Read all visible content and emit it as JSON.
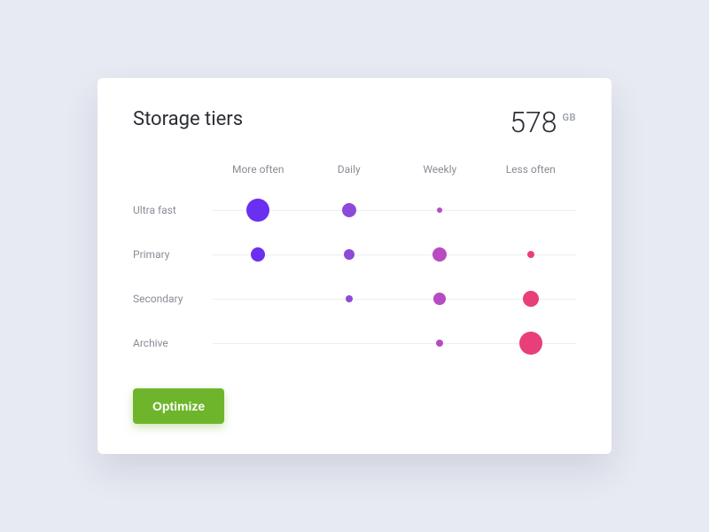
{
  "title": "Storage tiers",
  "total": {
    "value": "578",
    "unit": "GB"
  },
  "columns": [
    "More often",
    "Daily",
    "Weekly",
    "Less often"
  ],
  "rows": [
    "Ultra fast",
    "Primary",
    "Secondary",
    "Archive"
  ],
  "button": "Optimize",
  "colors": {
    "col0": "#6a2ff0",
    "col1": "#8f49d9",
    "col2": "#b84bc2",
    "col3": "#e83e7a",
    "accent": "#6fb52b"
  },
  "chart_data": {
    "type": "scatter",
    "title": "Storage tiers",
    "xlabel": "",
    "ylabel": "",
    "x_categories": [
      "More often",
      "Daily",
      "Weekly",
      "Less often"
    ],
    "y_categories": [
      "Ultra fast",
      "Primary",
      "Secondary",
      "Archive"
    ],
    "series": [
      {
        "name": "Ultra fast",
        "values": [
          26,
          16,
          6,
          0
        ]
      },
      {
        "name": "Primary",
        "values": [
          16,
          12,
          16,
          8
        ]
      },
      {
        "name": "Secondary",
        "values": [
          0,
          8,
          14,
          18
        ]
      },
      {
        "name": "Archive",
        "values": [
          0,
          0,
          8,
          26
        ]
      }
    ],
    "size_legend": "bubble diameter ~ relative volume (px)"
  }
}
